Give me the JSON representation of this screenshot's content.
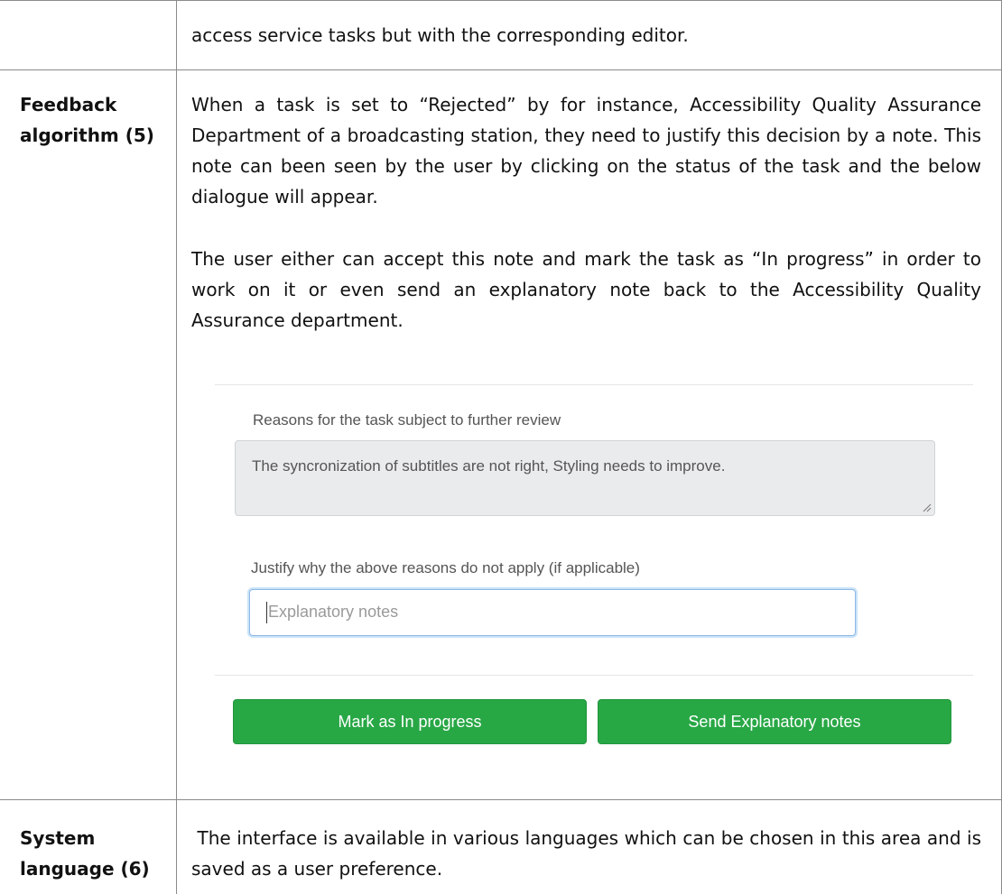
{
  "table": {
    "top_row": {
      "label": "",
      "content": "access service tasks but with the corresponding editor."
    },
    "feedback_row": {
      "label_line1": "Feedback",
      "label_line2": "algorithm (5)",
      "paragraph1": "When a task is set to “Rejected” by for instance, Accessibility Quality Assurance Department of a broadcasting station, they need to justify this decision by a note. This note can been seen by the user by clicking on the status of the task and the below dialogue will appear.",
      "paragraph2": "The user either can accept this note and mark the task as “In progress” in order to work on it or even send an explanatory note back to the Accessibility Quality Assurance department."
    },
    "language_row": {
      "label_line1": "System",
      "label_line2": "language (6)",
      "content": " The interface is available in various languages which can be chosen in this area and is saved as a user preference."
    }
  },
  "dialog": {
    "reasons_label": "Reasons for the task subject to further review",
    "reasons_value": "The syncronization of subtitles are not right, Styling needs to improve.",
    "justify_label": "Justify why the above reasons do not apply (if applicable)",
    "notes_placeholder": "Explanatory notes",
    "mark_in_progress_label": "Mark as In progress",
    "send_notes_label": "Send Explanatory notes",
    "button_color": "#28a745",
    "focus_ring_color": "#8fb8e6"
  },
  "icons": {
    "resize_handle": "resize-grip-icon"
  }
}
